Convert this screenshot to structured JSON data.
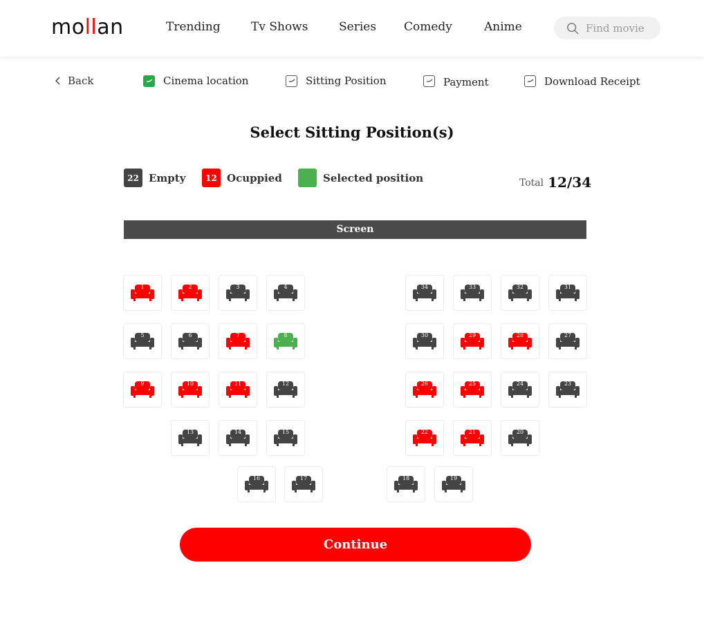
{
  "header": {
    "logo_prefix": "mo",
    "logo_accent": "ll",
    "logo_suffix": "an",
    "nav": [
      "Trending",
      "Tv Shows",
      "Series",
      "Comedy",
      "Anime"
    ],
    "search_placeholder": "Find movie",
    "search_icon": "search-icon"
  },
  "steps": {
    "back_label": "Back",
    "items": [
      {
        "label": "Cinema location",
        "done": true
      },
      {
        "label": "Sitting Position",
        "done": false
      },
      {
        "label": "Payment",
        "done": false
      },
      {
        "label": "Download Receipt",
        "done": false
      }
    ]
  },
  "title": "Select Sitting Position(s)",
  "legend": {
    "empty": {
      "count": "22",
      "label": "Empty",
      "color": "#444444"
    },
    "occupied": {
      "count": "12",
      "label": "Ocuppied",
      "color": "#ff0000"
    },
    "selected": {
      "label": "Selected position",
      "color": "#4caf50"
    }
  },
  "total": {
    "label": "Total",
    "value": "12/34"
  },
  "screen_label": "Screen",
  "seats": [
    {
      "number": "1",
      "status": "occupied"
    },
    {
      "number": "2",
      "status": "occupied"
    },
    {
      "number": "3",
      "status": "empty"
    },
    {
      "number": "4",
      "status": "empty"
    },
    {
      "number": "5",
      "status": "empty"
    },
    {
      "number": "6",
      "status": "empty"
    },
    {
      "number": "7",
      "status": "occupied"
    },
    {
      "number": "8",
      "status": "selected"
    },
    {
      "number": "9",
      "status": "occupied"
    },
    {
      "number": "10",
      "status": "occupied"
    },
    {
      "number": "11",
      "status": "occupied"
    },
    {
      "number": "12",
      "status": "empty"
    },
    {
      "number": "13",
      "status": "empty"
    },
    {
      "number": "14",
      "status": "empty"
    },
    {
      "number": "15",
      "status": "empty"
    },
    {
      "number": "16",
      "status": "empty"
    },
    {
      "number": "17",
      "status": "empty"
    },
    {
      "number": "18",
      "status": "empty"
    },
    {
      "number": "19",
      "status": "empty"
    },
    {
      "number": "20",
      "status": "empty"
    },
    {
      "number": "21",
      "status": "occupied"
    },
    {
      "number": "22",
      "status": "occupied"
    },
    {
      "number": "23",
      "status": "empty"
    },
    {
      "number": "24",
      "status": "empty"
    },
    {
      "number": "25",
      "status": "occupied"
    },
    {
      "number": "26",
      "status": "occupied"
    },
    {
      "number": "27",
      "status": "empty"
    },
    {
      "number": "28",
      "status": "occupied"
    },
    {
      "number": "29",
      "status": "occupied"
    },
    {
      "number": "30",
      "status": "empty"
    },
    {
      "number": "31",
      "status": "empty"
    },
    {
      "number": "32",
      "status": "empty"
    },
    {
      "number": "33",
      "status": "empty"
    },
    {
      "number": "34",
      "status": "empty"
    }
  ],
  "colors": {
    "empty": "#444444",
    "occupied": "#ff0000",
    "selected": "#4caf50"
  },
  "continue_label": "Continue"
}
